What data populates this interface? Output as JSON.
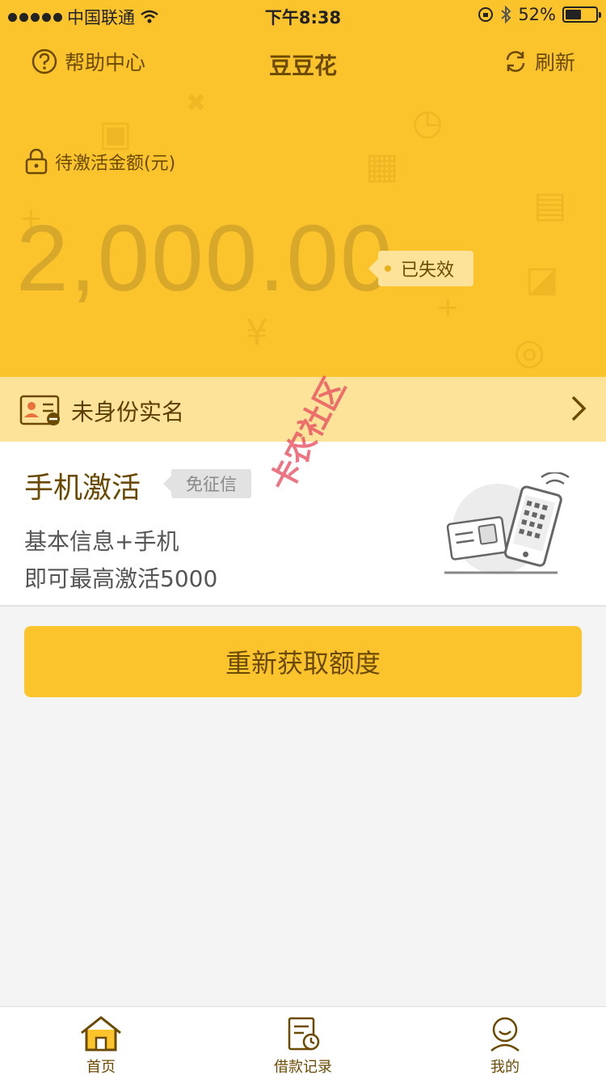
{
  "status_bar": {
    "carrier": "中国联通",
    "time": "下午8:38",
    "battery": "52%",
    "battery_level": 0.52
  },
  "nav": {
    "help_label": "帮助中心",
    "title": "豆豆花",
    "refresh_label": "刷新"
  },
  "amount": {
    "label": "待激活金额(元)",
    "value": "2,000.00",
    "status": "已失效"
  },
  "identity": {
    "label": "未身份实名"
  },
  "activation": {
    "title": "手机激活",
    "badge": "免征信",
    "line1": "基本信息+手机",
    "line2": "即可最高激活5000"
  },
  "watermark": "卡农社区",
  "main_button": {
    "label": "重新获取额度"
  },
  "tabbar": {
    "items": [
      {
        "label": "首页",
        "icon": "home-icon"
      },
      {
        "label": "借款记录",
        "icon": "loan-record-icon"
      },
      {
        "label": "我的",
        "icon": "profile-icon"
      }
    ]
  },
  "colors": {
    "accent": "#fbc42d",
    "accent_light": "#fde39a",
    "text_brown": "#6b4a00"
  }
}
